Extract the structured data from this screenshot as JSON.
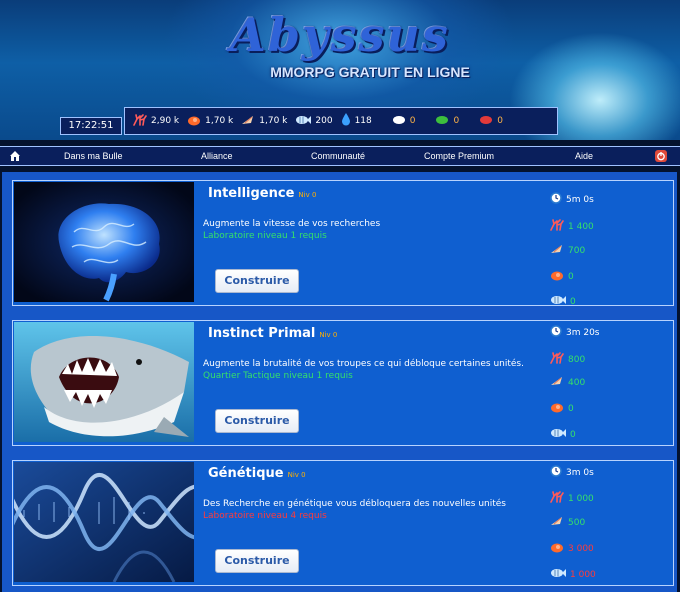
{
  "brand": {
    "logo": "Abyssus",
    "tagline": "MMORPG GRATUIT EN LIGNE"
  },
  "clock": "17:22:51",
  "resources": [
    {
      "icon": "coral-icon",
      "value": "2,90 k",
      "color": "#ff5a5a"
    },
    {
      "icon": "shell-icon",
      "value": "1,70 k",
      "color": "#ff6a2a"
    },
    {
      "icon": "conch-icon",
      "value": "1,70 k",
      "color": "#f5d2b0"
    },
    {
      "icon": "fish-icon",
      "value": "200",
      "color": "#cfe9ff"
    },
    {
      "icon": "water-drop-icon",
      "value": "118",
      "color": "#3ba1ff"
    },
    {
      "icon": "white-pearl-icon",
      "value": "0",
      "color": "#ffffff"
    },
    {
      "icon": "green-gem-icon",
      "value": "0",
      "color": "#3dbf3d"
    },
    {
      "icon": "red-gem-icon",
      "value": "0",
      "color": "#e33a3a"
    }
  ],
  "menu": [
    "Dans ma Bulle",
    "Alliance",
    "Communauté",
    "Compte Premium",
    "Aide"
  ],
  "researches": [
    {
      "title": "Intelligence",
      "level": "Niv 0",
      "description": "Augmente la vitesse de vos recherches",
      "requirement": "Laboratoire niveau 1 requis",
      "requirement_ok": true,
      "button": "Construire",
      "image": "brain-image",
      "time": "5m 0s",
      "costs": [
        {
          "icon": "coral-icon",
          "value": "1 400",
          "ok": true
        },
        {
          "icon": "conch-icon",
          "value": "700",
          "ok": true
        },
        {
          "icon": "shell-icon",
          "value": "0",
          "ok": true
        },
        {
          "icon": "fish-icon",
          "value": "0",
          "ok": true
        }
      ]
    },
    {
      "title": "Instinct Primal",
      "level": "Niv 0",
      "description": "Augmente la brutalité de vos troupes ce qui débloque certaines unités.",
      "requirement": "Quartier Tactique niveau 1 requis",
      "requirement_ok": true,
      "button": "Construire",
      "image": "shark-image",
      "time": "3m 20s",
      "costs": [
        {
          "icon": "coral-icon",
          "value": "800",
          "ok": true
        },
        {
          "icon": "conch-icon",
          "value": "400",
          "ok": true
        },
        {
          "icon": "shell-icon",
          "value": "0",
          "ok": true
        },
        {
          "icon": "fish-icon",
          "value": "0",
          "ok": true
        }
      ]
    },
    {
      "title": "Génétique",
      "level": "Niv 0",
      "description": "Des Recherche en génétique vous débloquera des nouvelles unités",
      "requirement": "Laboratoire niveau 4 requis",
      "requirement_ok": false,
      "button": "Construire",
      "image": "dna-image",
      "time": "3m 0s",
      "costs": [
        {
          "icon": "coral-icon",
          "value": "1 000",
          "ok": true
        },
        {
          "icon": "conch-icon",
          "value": "500",
          "ok": true
        },
        {
          "icon": "shell-icon",
          "value": "3 000",
          "ok": false
        },
        {
          "icon": "fish-icon",
          "value": "1 000",
          "ok": false
        }
      ]
    }
  ]
}
